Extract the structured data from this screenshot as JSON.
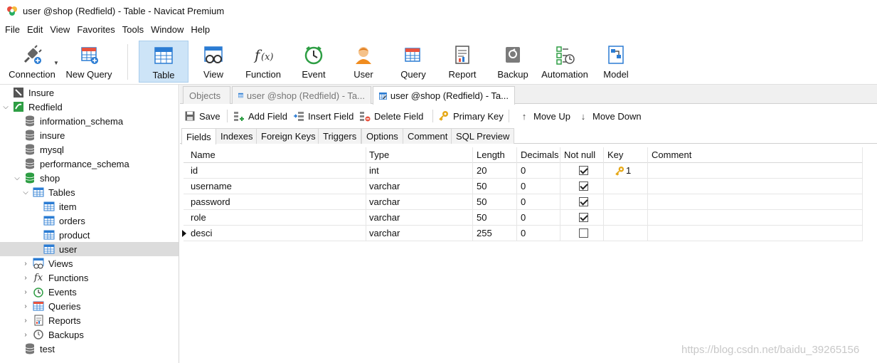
{
  "window": {
    "title": "user @shop (Redfield) - Table - Navicat Premium"
  },
  "menu": [
    "File",
    "Edit",
    "View",
    "Favorites",
    "Tools",
    "Window",
    "Help"
  ],
  "toolbar": {
    "connection": "Connection",
    "new_query": "New Query",
    "table": "Table",
    "view": "View",
    "function": "Function",
    "event": "Event",
    "user": "User",
    "query": "Query",
    "report": "Report",
    "backup": "Backup",
    "automation": "Automation",
    "model": "Model"
  },
  "sidebar": {
    "items": [
      {
        "label": "Insure"
      },
      {
        "label": "Redfield"
      },
      {
        "label": "information_schema"
      },
      {
        "label": "insure"
      },
      {
        "label": "mysql"
      },
      {
        "label": "performance_schema"
      },
      {
        "label": "shop"
      },
      {
        "label": "Tables"
      },
      {
        "label": "item"
      },
      {
        "label": "orders"
      },
      {
        "label": "product"
      },
      {
        "label": "user"
      },
      {
        "label": "Views"
      },
      {
        "label": "Functions"
      },
      {
        "label": "Events"
      },
      {
        "label": "Queries"
      },
      {
        "label": "Reports"
      },
      {
        "label": "Backups"
      },
      {
        "label": "test"
      }
    ]
  },
  "doc_tabs": {
    "objects": "Objects",
    "tab1": "user @shop (Redfield) - Ta...",
    "tab2": "user @shop (Redfield) - Ta..."
  },
  "editor_toolbar": {
    "save": "Save",
    "add_field": "Add Field",
    "insert_field": "Insert Field",
    "delete_field": "Delete Field",
    "primary_key": "Primary Key",
    "move_up": "Move Up",
    "move_down": "Move Down"
  },
  "sub_tabs": [
    "Fields",
    "Indexes",
    "Foreign Keys",
    "Triggers",
    "Options",
    "Comment",
    "SQL Preview"
  ],
  "grid": {
    "columns": [
      "Name",
      "Type",
      "Length",
      "Decimals",
      "Not null",
      "Key",
      "Comment"
    ],
    "rows": [
      {
        "name": "id",
        "type": "int",
        "length": "20",
        "decimals": "0",
        "not_null": true,
        "key": "1",
        "comment": ""
      },
      {
        "name": "username",
        "type": "varchar",
        "length": "50",
        "decimals": "0",
        "not_null": true,
        "key": "",
        "comment": ""
      },
      {
        "name": "password",
        "type": "varchar",
        "length": "50",
        "decimals": "0",
        "not_null": true,
        "key": "",
        "comment": ""
      },
      {
        "name": "role",
        "type": "varchar",
        "length": "50",
        "decimals": "0",
        "not_null": true,
        "key": "",
        "comment": ""
      },
      {
        "name": "desci",
        "type": "varchar",
        "length": "255",
        "decimals": "0",
        "not_null": false,
        "key": "",
        "comment": ""
      }
    ]
  },
  "watermark": "https://blog.csdn.net/baidu_39265156",
  "colors": {
    "active_toolbar_bg": "#cde4f7",
    "selected_tree_bg": "#dcdcdc"
  }
}
